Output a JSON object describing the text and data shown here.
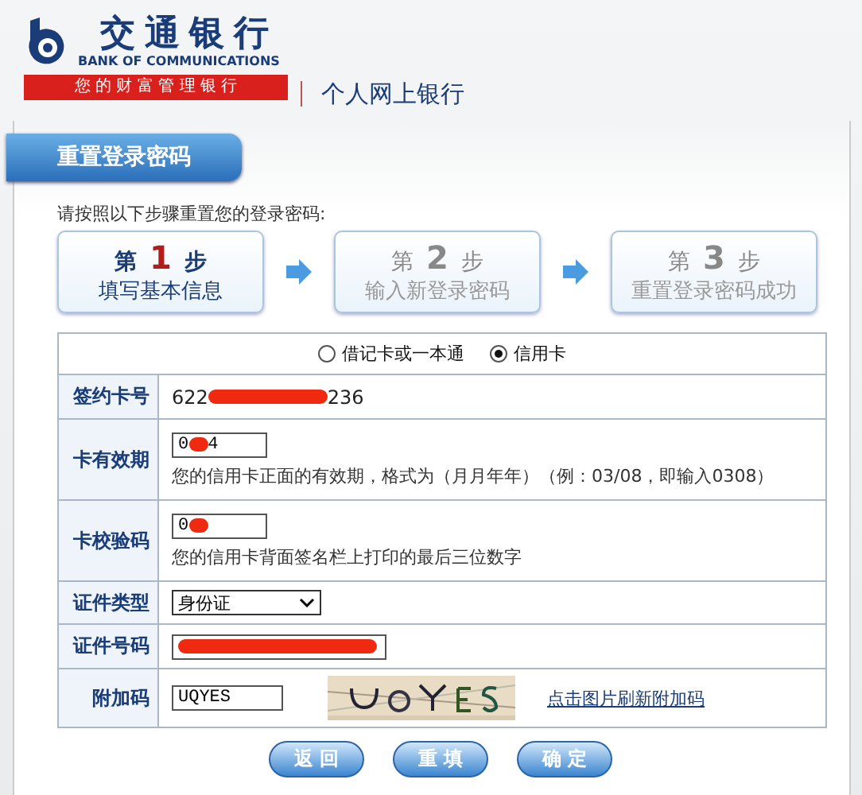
{
  "header": {
    "bank_name": "交通银行",
    "bank_name_en": "BANK OF COMMUNICATIONS",
    "slogan": "您 的 财 富 管 理 银 行",
    "site_title": "个人网上银行"
  },
  "panel": {
    "title": "重置登录密码",
    "instruction": "请按照以下步骤重置您的登录密码:"
  },
  "steps": [
    {
      "prefix": "第",
      "number": "1",
      "suffix": "步",
      "label": "填写基本信息",
      "selected": true
    },
    {
      "prefix": "第",
      "number": "2",
      "suffix": "步",
      "label": "输入新登录密码",
      "selected": false
    },
    {
      "prefix": "第",
      "number": "3",
      "suffix": "步",
      "label": "重置登录密码成功",
      "selected": false
    }
  ],
  "card_types": [
    {
      "label": "借记卡或一本通",
      "selected": false
    },
    {
      "label": "信用卡",
      "selected": true
    }
  ],
  "form_rows": [
    {
      "kind": "text",
      "label": "签约卡号",
      "value_start": "622",
      "value_end": "236"
    },
    {
      "kind": "input",
      "label": "卡有效期",
      "value_start": "0",
      "value_end": "4",
      "hint": "您的信用卡正面的有效期，格式为（月月年年）（例：03/08，即输入0308）"
    },
    {
      "kind": "input",
      "label": "卡校验码",
      "value_start": "0",
      "hint": "您的信用卡背面签名栏上打印的最后三位数字"
    },
    {
      "kind": "select",
      "label": "证件类型",
      "value": "身份证"
    },
    {
      "kind": "redacted",
      "label": "证件号码"
    },
    {
      "kind": "captcha",
      "label": "附加码",
      "value": "UQYES",
      "link": "点击图片刷新附加码"
    }
  ],
  "buttons": [
    "返 回",
    "重 填",
    "确 定"
  ]
}
